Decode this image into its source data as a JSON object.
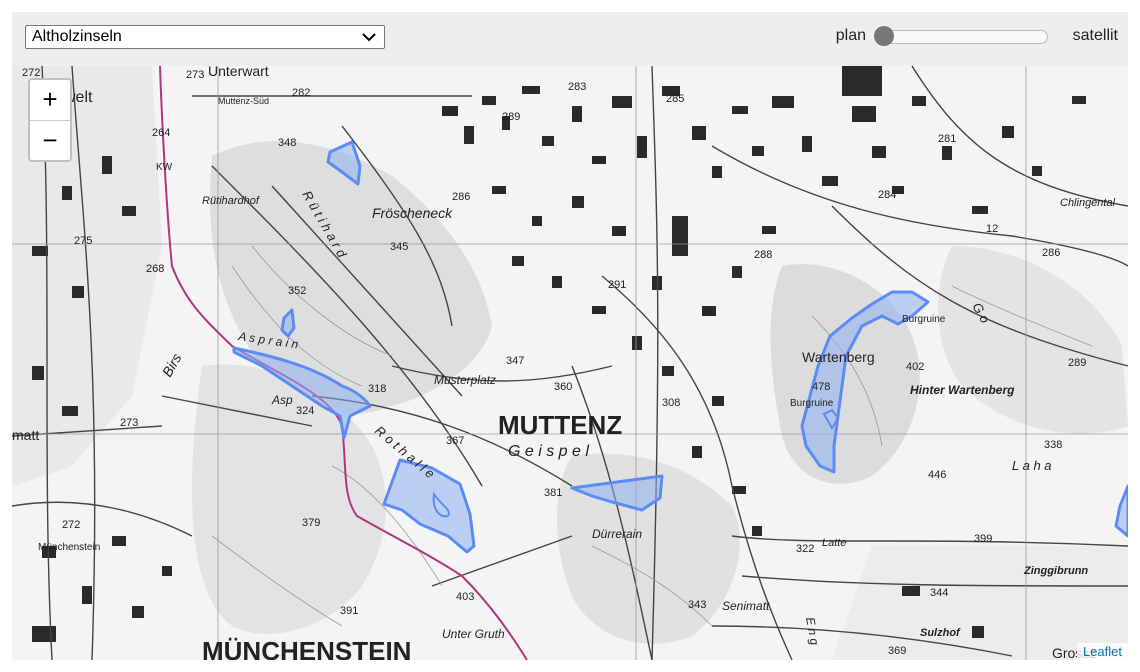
{
  "layer_select": {
    "value": "Altholzinseln"
  },
  "basemap_toggle": {
    "left_label": "plan",
    "right_label": "satellit",
    "position": 0
  },
  "zoom": {
    "in": "+",
    "out": "−"
  },
  "attribution": "Leaflet",
  "colors": {
    "polygon_stroke": "#5b8cf5",
    "polygon_fill": "#8eaef2",
    "river": "#b0367a",
    "toggle_bar": "#eeeeee"
  },
  "map": {
    "labels": {
      "muttenz": "MUTTENZ",
      "muenchenstein": "MÜNCHENSTEIN",
      "geispel": "G e i s p e l",
      "froescheneck": "Fröscheneck",
      "ruetihardhof": "Rütihardhof",
      "musterplatz": "Musterplatz",
      "wartenberg": "Wartenberg",
      "hinter_wartenberg": "Hinter Wartenberg",
      "burgruine_1": "Burgruine",
      "burgruine_2": "Burgruine",
      "duerrerain": "Dürrerain",
      "senimatt": "Senimatt",
      "zinggibrunn": "Zinggibrunn",
      "sulzhof": "Sulzhof",
      "unter_gruth": "Unter Gruth",
      "chlingental": "Chlingental",
      "asp": "Asp",
      "aspnain": "A s p r a i n",
      "birs": "Birs",
      "latte": "Latte",
      "muenchenstein_small": "Münchenstein",
      "muttenz_sued": "Muttenz-Süd",
      "unterwart": "Unterwart",
      "ruetihard": "R ü t i h a r d",
      "rothalle": "R o t h a l l e",
      "laha": "L a h a",
      "matt": "matt",
      "welt": "welt",
      "grossz": "Grossz",
      "kw": "KW",
      "go": "G o",
      "eng": "E n g"
    },
    "elevations": {
      "e272a": "272",
      "e273a": "273",
      "e282": "282",
      "e283": "283",
      "e285": "285",
      "e289a": "289",
      "e348": "348",
      "e264": "264",
      "e286a": "286",
      "e345": "345",
      "e352": "352",
      "e275": "275",
      "e268": "268",
      "e347": "347",
      "e360": "360",
      "e318": "318",
      "e324": "324",
      "e367": "367",
      "e381": "381",
      "e379": "379",
      "e391": "391",
      "e403": "403",
      "e273b": "273",
      "e272b": "272",
      "e291": "291",
      "e288": "288",
      "e308": "308",
      "e281": "281",
      "e284": "284",
      "e286b": "286",
      "e289b": "289",
      "e402": "402",
      "e478": "478",
      "e338": "338",
      "e446": "446",
      "e399": "399",
      "e322": "322",
      "e343": "343",
      "e344": "344",
      "e369": "369",
      "e12": "12"
    }
  }
}
